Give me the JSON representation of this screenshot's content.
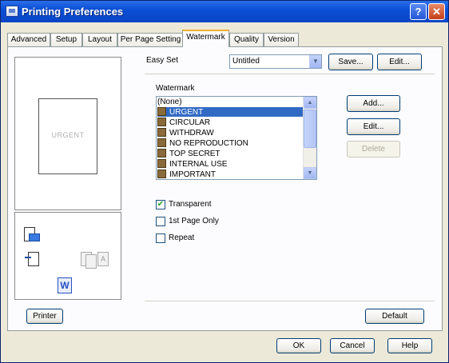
{
  "window": {
    "title": "Printing Preferences",
    "help_glyph": "?",
    "close_glyph": "✕"
  },
  "tabs": [
    "Advanced",
    "Setup",
    "Layout",
    "Per Page Setting",
    "Watermark",
    "Quality",
    "Version"
  ],
  "active_tab": "Watermark",
  "easy_set": {
    "label": "Easy Set",
    "value": "Untitled",
    "save_label": "Save...",
    "edit_label": "Edit..."
  },
  "preview": {
    "watermark_text": "URGENT",
    "w_glyph": "W",
    "a_glyph": "A"
  },
  "watermark": {
    "group_label": "Watermark",
    "items": [
      "(None)",
      "URGENT",
      "CIRCULAR",
      "WITHDRAW",
      "NO REPRODUCTION",
      "TOP SECRET",
      "INTERNAL USE",
      "IMPORTANT"
    ],
    "selected": "URGENT",
    "add_label": "Add...",
    "edit_label": "Edit...",
    "delete_label": "Delete"
  },
  "options": {
    "transparent": {
      "label": "Transparent",
      "checked": true
    },
    "first_page_only": {
      "label": "1st Page Only",
      "checked": false
    },
    "repeat": {
      "label": "Repeat",
      "checked": false
    }
  },
  "buttons": {
    "printer": "Printer",
    "default": "Default",
    "ok": "OK",
    "cancel": "Cancel",
    "help": "Help"
  },
  "colors": {
    "titlebar": "#0a4fd6",
    "selection": "#316ac5",
    "tab_highlight": "#f0b030"
  }
}
